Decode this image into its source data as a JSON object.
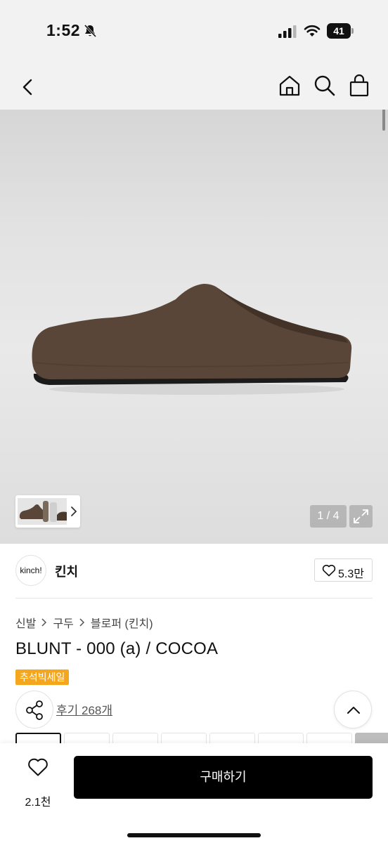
{
  "status_bar": {
    "time": "1:52",
    "battery_level": "41",
    "icons": [
      "bell-muted-icon",
      "signal-icon",
      "wifi-icon",
      "battery-icon"
    ]
  },
  "nav": {
    "icons": [
      "back-icon",
      "home-icon",
      "search-icon",
      "shopping-bag-icon"
    ]
  },
  "gallery": {
    "counter": "1 / 4",
    "current_image": 1,
    "total_images": 4,
    "icons": [
      "chevron-right-icon",
      "expand-icon"
    ]
  },
  "brand": {
    "logo_text": "kinch!",
    "name": "킨치",
    "likes": "5.3만"
  },
  "breadcrumb": {
    "items": [
      "신발",
      "구두",
      "블로퍼 (킨치)"
    ]
  },
  "product": {
    "title": "BLUNT - 000 (a) / COCOA",
    "badge": "추석빅세일",
    "reviews_link": "후기 268개"
  },
  "bottom_bar": {
    "wish_count": "2.1천",
    "buy_label": "구매하기"
  },
  "colors": {
    "accent_badge": "#f4a61c",
    "buy_button": "#000000",
    "shoe": "#5a4638"
  }
}
